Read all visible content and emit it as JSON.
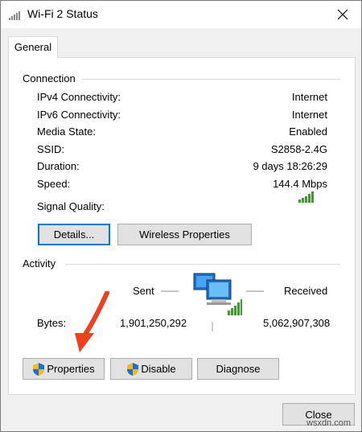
{
  "window": {
    "title": "Wi-Fi 2 Status",
    "tab": "General",
    "title_icon": "wifi-signal-icon"
  },
  "connection": {
    "section_label": "Connection",
    "rows": [
      {
        "label": "IPv4 Connectivity:",
        "value": "Internet"
      },
      {
        "label": "IPv6 Connectivity:",
        "value": "Internet"
      },
      {
        "label": "Media State:",
        "value": "Enabled"
      },
      {
        "label": "SSID:",
        "value": "S2858-2.4G"
      },
      {
        "label": "Duration:",
        "value": "9 days 18:26:29"
      },
      {
        "label": "Speed:",
        "value": "144.4 Mbps"
      }
    ],
    "signal_label": "Signal Quality:",
    "signal_bars": 5,
    "signal_color": "#3c9a2e",
    "details_button": "Details...",
    "wireless_button": "Wireless Properties"
  },
  "activity": {
    "section_label": "Activity",
    "sent_label": "Sent",
    "received_label": "Received",
    "bytes_label": "Bytes:",
    "bytes_sent": "1,901,250,292",
    "bytes_received": "5,062,907,308",
    "icon": "network-computers-icon"
  },
  "buttons": {
    "properties": "Properties",
    "disable": "Disable",
    "diagnose": "Diagnose",
    "close": "Close"
  },
  "annotation": {
    "arrow_color": "#f0401e",
    "arrow_icon": "red-arrow-pointer"
  },
  "watermark": "wsxdn.com"
}
